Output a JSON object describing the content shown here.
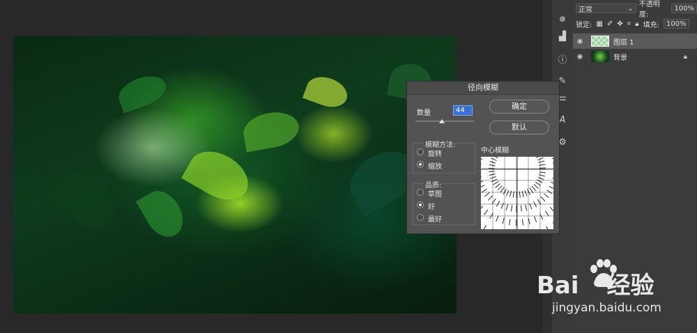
{
  "layers_panel": {
    "blend_mode": "正常",
    "opacity_label": "不透明度:",
    "opacity_value": "100%",
    "lock_label": "锁定:",
    "fill_label": "填充:",
    "fill_value": "100%",
    "layers": [
      {
        "name": "图层 1"
      },
      {
        "name": "背景"
      }
    ]
  },
  "dialog": {
    "title": "径向模糊",
    "amount_label": "数量",
    "amount_value": "44",
    "ok_label": "确定",
    "default_label": "默认",
    "method_label": "模糊方法:",
    "method_options": [
      "旋转",
      "缩放"
    ],
    "method_selected": "缩放",
    "quality_label": "品质:",
    "quality_options": [
      "草图",
      "好",
      "最好"
    ],
    "quality_selected": "好",
    "center_label": "中心模糊"
  },
  "watermark": {
    "logo_text_left": "Bai",
    "logo_text_right": "经验",
    "url": "jingyan.baidu.com"
  },
  "colors": {
    "accent": "#3a6fd8",
    "panel": "#3b3b3b",
    "dialog": "#535353"
  }
}
